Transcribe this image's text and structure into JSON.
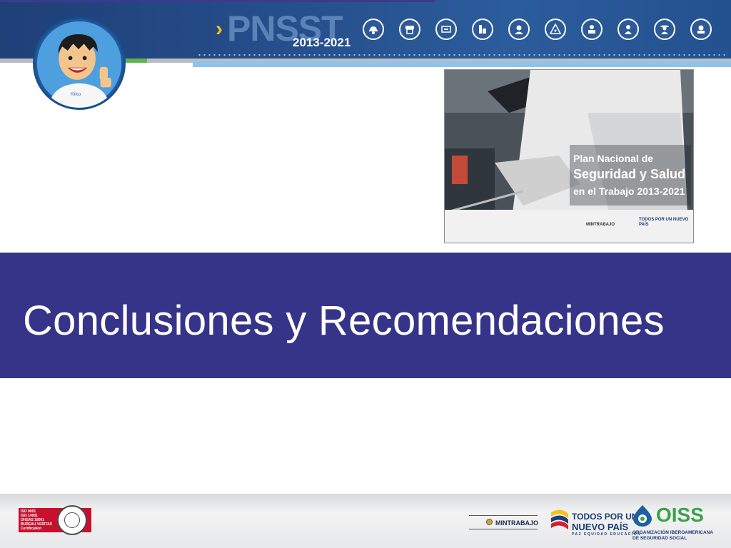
{
  "header": {
    "brand_name": "PNSST",
    "brand_years": "2013-2021",
    "icons": [
      "construction-worker-icon",
      "firefighter-icon",
      "machinery-icon",
      "factory-icon",
      "mining-worker-icon",
      "chemical-hazard-icon",
      "transport-worker-icon",
      "health-worker-icon",
      "farmer-icon",
      "safety-gear-icon"
    ]
  },
  "mascot": {
    "shirt_label": "Kiko"
  },
  "cover": {
    "title_line1": "Plan Nacional de",
    "title_line2": "Seguridad y Salud",
    "title_line3": "en el Trabajo 2013-2021",
    "footer_left": "MINTRABAJO",
    "footer_right": "TODOS POR UN NUEVO PAÍS"
  },
  "banner": {
    "title": "Conclusiones y Recomendaciones"
  },
  "footer": {
    "bureau_veritas": {
      "lines": [
        "ISO 9001",
        "ISO 14001",
        "OHSAS 18001",
        "BUREAU VERITAS",
        "Certification"
      ]
    },
    "mintrabajo": "MINTRABAJO",
    "todos_por_un": "TODOS POR UN",
    "nuevo_pais": "NUEVO PAÍS",
    "tagline": "PAZ  EQUIDAD  EDUCACIÓN",
    "oiss": "OISS",
    "oiss_sub1": "ORGANIZACIÓN IBEROAMERICANA",
    "oiss_sub2": "DE SEGURIDAD SOCIAL"
  },
  "colors": {
    "banner": "#363489",
    "header": "#24518f",
    "oiss_green": "#3aa24a",
    "accent_yellow": "#f2c417"
  }
}
